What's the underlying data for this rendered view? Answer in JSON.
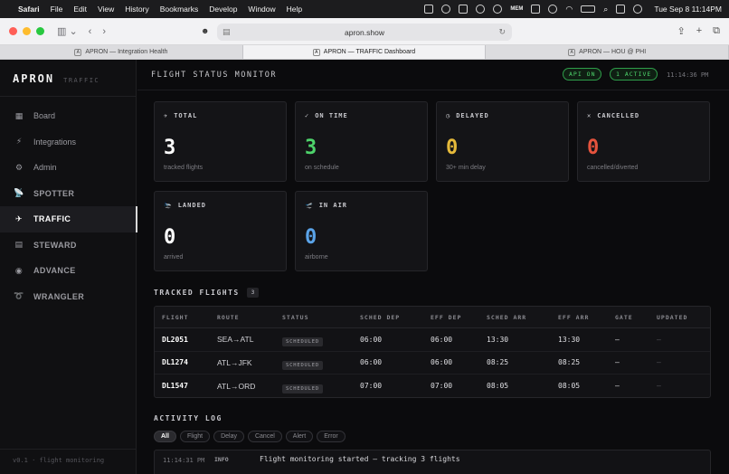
{
  "menubar": {
    "app": "Safari",
    "items": [
      "File",
      "Edit",
      "View",
      "History",
      "Bookmarks",
      "Develop",
      "Window",
      "Help"
    ],
    "mem_label": "MEM",
    "clock": "Tue Sep 8  11:14PM"
  },
  "browser": {
    "url": "apron.show",
    "tabs": [
      {
        "label": "APRON — Integration Health",
        "active": false
      },
      {
        "label": "APRON — TRAFFIC Dashboard",
        "active": true
      },
      {
        "label": "APRON — HOU @ PHI",
        "active": false
      }
    ]
  },
  "sidebar": {
    "brand": "APRON",
    "brand_sub": "TRAFFIC",
    "items": [
      {
        "label": "Board",
        "icon": "clipboard-icon",
        "glyph": "▦",
        "active": false
      },
      {
        "label": "Integrations",
        "icon": "plug-icon",
        "glyph": "⚡",
        "active": false
      },
      {
        "label": "Admin",
        "icon": "gear-icon",
        "glyph": "⚙",
        "active": false
      },
      {
        "label": "SPOTTER",
        "icon": "satellite-icon",
        "glyph": "📡",
        "active": false
      },
      {
        "label": "TRAFFIC",
        "icon": "plane-icon",
        "glyph": "✈",
        "active": true
      },
      {
        "label": "STEWARD",
        "icon": "book-icon",
        "glyph": "▤",
        "active": false
      },
      {
        "label": "ADVANCE",
        "icon": "compass-icon",
        "glyph": "◉",
        "active": false
      },
      {
        "label": "WRANGLER",
        "icon": "lasso-icon",
        "glyph": "➰",
        "active": false
      }
    ],
    "footer": "v0.1 · flight monitoring"
  },
  "header": {
    "title": "FLIGHT STATUS MONITOR",
    "api_status": "API ON",
    "active_count": "1 ACTIVE",
    "time": "11:14:36 PM"
  },
  "cards": [
    {
      "label": "TOTAL",
      "glyph": "✈",
      "value": "3",
      "sub": "tracked flights",
      "color": "#ffffff"
    },
    {
      "label": "ON TIME",
      "glyph": "✓",
      "value": "3",
      "sub": "on schedule",
      "color": "#4ed36b"
    },
    {
      "label": "DELAYED",
      "glyph": "◷",
      "value": "0",
      "sub": "30+ min delay",
      "color": "#e5b93a"
    },
    {
      "label": "CANCELLED",
      "glyph": "✕",
      "value": "0",
      "sub": "cancelled/diverted",
      "color": "#e5533d"
    },
    {
      "label": "LANDED",
      "glyph": "🛬",
      "value": "0",
      "sub": "arrived",
      "color": "#ffffff"
    },
    {
      "label": "IN AIR",
      "glyph": "🛫",
      "value": "0",
      "sub": "airborne",
      "color": "#5aa3e8"
    }
  ],
  "flights": {
    "title": "TRACKED FLIGHTS",
    "count": "3",
    "columns": [
      "FLIGHT",
      "ROUTE",
      "STATUS",
      "SCHED DEP",
      "EFF DEP",
      "SCHED ARR",
      "EFF ARR",
      "GATE",
      "UPDATED"
    ],
    "rows": [
      {
        "flight": "DL2051",
        "route": "SEA→ATL",
        "status": "SCHEDULED",
        "sched_dep": "06:00",
        "eff_dep": "06:00",
        "sched_arr": "13:30",
        "eff_arr": "13:30",
        "gate": "—",
        "updated": "—"
      },
      {
        "flight": "DL1274",
        "route": "ATL→JFK",
        "status": "SCHEDULED",
        "sched_dep": "06:00",
        "eff_dep": "06:00",
        "sched_arr": "08:25",
        "eff_arr": "08:25",
        "gate": "—",
        "updated": "—"
      },
      {
        "flight": "DL1547",
        "route": "ATL→ORD",
        "status": "SCHEDULED",
        "sched_dep": "07:00",
        "eff_dep": "07:00",
        "sched_arr": "08:05",
        "eff_arr": "08:05",
        "gate": "—",
        "updated": "—"
      }
    ]
  },
  "activity": {
    "title": "ACTIVITY LOG",
    "filters": [
      {
        "label": "All",
        "active": true
      },
      {
        "label": "Flight",
        "active": false
      },
      {
        "label": "Delay",
        "active": false
      },
      {
        "label": "Cancel",
        "active": false
      },
      {
        "label": "Alert",
        "active": false
      },
      {
        "label": "Error",
        "active": false
      }
    ],
    "entries": [
      {
        "time": "11:14:31 PM",
        "level": "INFO",
        "message": "Flight monitoring started — tracking 3 flights"
      }
    ]
  }
}
